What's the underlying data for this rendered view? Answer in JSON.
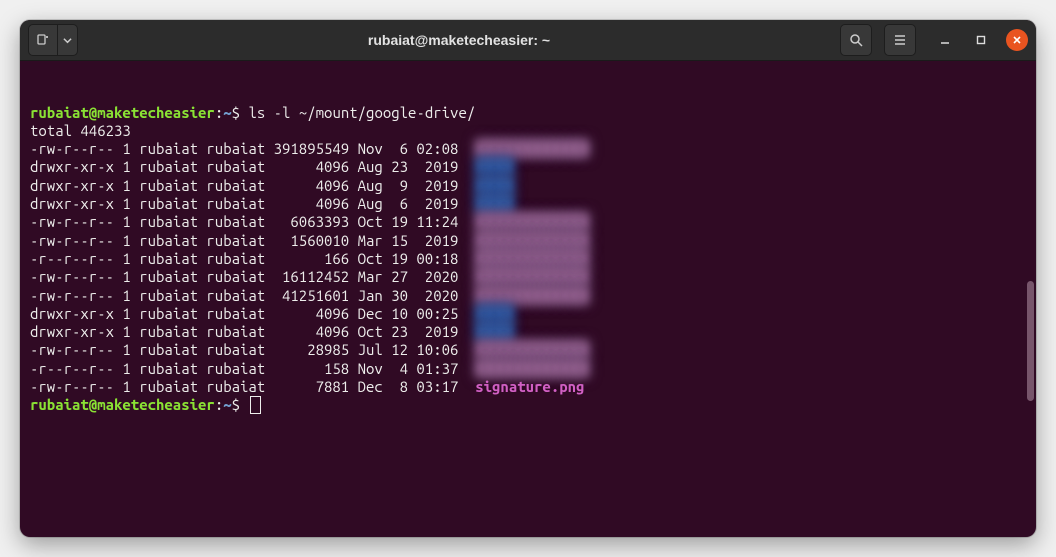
{
  "window": {
    "title": "rubaiat@maketecheasier: ~"
  },
  "prompt": {
    "userhost": "rubaiat@maketecheasier",
    "path": "~",
    "sep": ":",
    "suffix": "$"
  },
  "command": "ls -l ~/mount/google-drive/",
  "total_line": "total 446233",
  "listing": [
    {
      "perms": "-rw-r--r--",
      "links": "1",
      "owner": "rubaiat",
      "group": "rubaiat",
      "size": "391895549",
      "date": "Nov  6 02:08",
      "type": "blur-file"
    },
    {
      "perms": "drwxr-xr-x",
      "links": "1",
      "owner": "rubaiat",
      "group": "rubaiat",
      "size": "4096",
      "date": "Aug 23  2019",
      "type": "blur-dir"
    },
    {
      "perms": "drwxr-xr-x",
      "links": "1",
      "owner": "rubaiat",
      "group": "rubaiat",
      "size": "4096",
      "date": "Aug  9  2019",
      "type": "blur-dir"
    },
    {
      "perms": "drwxr-xr-x",
      "links": "1",
      "owner": "rubaiat",
      "group": "rubaiat",
      "size": "4096",
      "date": "Aug  6  2019",
      "type": "blur-dir"
    },
    {
      "perms": "-rw-r--r--",
      "links": "1",
      "owner": "rubaiat",
      "group": "rubaiat",
      "size": "6063393",
      "date": "Oct 19 11:24",
      "type": "blur-file"
    },
    {
      "perms": "-rw-r--r--",
      "links": "1",
      "owner": "rubaiat",
      "group": "rubaiat",
      "size": "1560010",
      "date": "Mar 15  2019",
      "type": "blur-file"
    },
    {
      "perms": "-r--r--r--",
      "links": "1",
      "owner": "rubaiat",
      "group": "rubaiat",
      "size": "166",
      "date": "Oct 19 00:18",
      "type": "blur-file"
    },
    {
      "perms": "-rw-r--r--",
      "links": "1",
      "owner": "rubaiat",
      "group": "rubaiat",
      "size": "16112452",
      "date": "Mar 27  2020",
      "type": "blur-file"
    },
    {
      "perms": "-rw-r--r--",
      "links": "1",
      "owner": "rubaiat",
      "group": "rubaiat",
      "size": "41251601",
      "date": "Jan 30  2020",
      "type": "blur-file"
    },
    {
      "perms": "drwxr-xr-x",
      "links": "1",
      "owner": "rubaiat",
      "group": "rubaiat",
      "size": "4096",
      "date": "Dec 10 00:25",
      "type": "blur-dir"
    },
    {
      "perms": "drwxr-xr-x",
      "links": "1",
      "owner": "rubaiat",
      "group": "rubaiat",
      "size": "4096",
      "date": "Oct 23  2019",
      "type": "blur-dir"
    },
    {
      "perms": "-rw-r--r--",
      "links": "1",
      "owner": "rubaiat",
      "group": "rubaiat",
      "size": "28985",
      "date": "Jul 12 10:06",
      "type": "blur-file"
    },
    {
      "perms": "-r--r--r--",
      "links": "1",
      "owner": "rubaiat",
      "group": "rubaiat",
      "size": "158",
      "date": "Nov  4 01:37",
      "type": "blur-file"
    },
    {
      "perms": "-rw-r--r--",
      "links": "1",
      "owner": "rubaiat",
      "group": "rubaiat",
      "size": "7881",
      "date": "Dec  8 03:17",
      "type": "pink",
      "name": "signature.png"
    }
  ]
}
